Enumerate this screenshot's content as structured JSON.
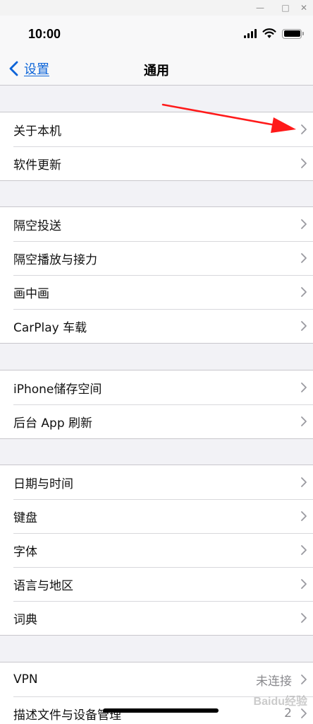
{
  "window_controls": {
    "minimize": "—",
    "maximize": "□",
    "close": "✕"
  },
  "status_bar": {
    "time": "10:00"
  },
  "nav": {
    "back_label": "设置",
    "title": "通用"
  },
  "groups": [
    {
      "rows": [
        {
          "label": "关于本机"
        },
        {
          "label": "软件更新"
        }
      ]
    },
    {
      "rows": [
        {
          "label": "隔空投送"
        },
        {
          "label": "隔空播放与接力"
        },
        {
          "label": "画中画"
        },
        {
          "label": "CarPlay 车载"
        }
      ]
    },
    {
      "rows": [
        {
          "label": "iPhone储存空间"
        },
        {
          "label": "后台 App 刷新"
        }
      ]
    },
    {
      "rows": [
        {
          "label": "日期与时间"
        },
        {
          "label": "键盘"
        },
        {
          "label": "字体"
        },
        {
          "label": "语言与地区"
        },
        {
          "label": "词典"
        }
      ]
    },
    {
      "rows": [
        {
          "label": "VPN",
          "value": "未连接"
        },
        {
          "label": "描述文件与设备管理",
          "value": "2"
        }
      ]
    }
  ],
  "watermark": "Baidu经验",
  "colors": {
    "accent": "#0a63d8",
    "annotation_arrow": "#ff1a1a",
    "background": "#f2f2f6"
  },
  "icons": [
    "minimize-icon",
    "maximize-icon",
    "close-icon",
    "signal-icon",
    "wifi-icon",
    "battery-icon",
    "back-chevron-icon",
    "chevron-right-icon",
    "annotation-arrow"
  ]
}
